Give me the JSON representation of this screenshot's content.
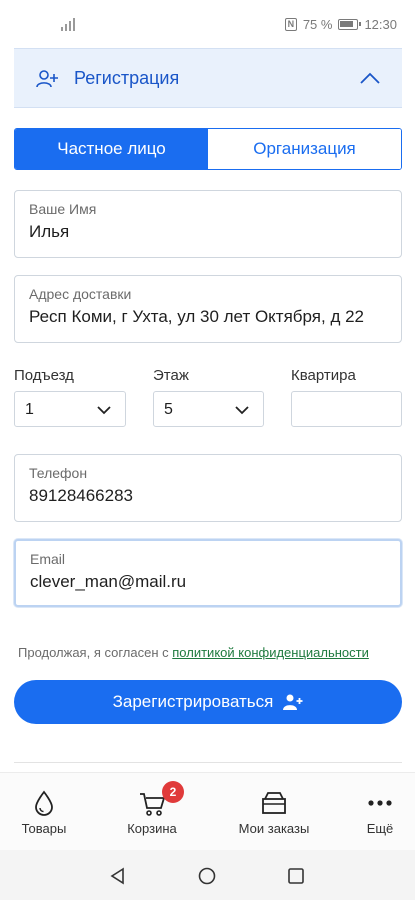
{
  "status_bar": {
    "battery_percent": "75 %",
    "time": "12:30"
  },
  "registration": {
    "title": "Регистрация",
    "expanded": true
  },
  "customer_type": {
    "options": [
      "Частное лицо",
      "Организация"
    ],
    "selected": "Частное лицо"
  },
  "form": {
    "name": {
      "label": "Ваше Имя",
      "value": "Илья"
    },
    "address": {
      "label": "Адрес доставки",
      "value": "Респ Коми, г Ухта, ул 30 лет Октября, д 22"
    },
    "entrance": {
      "label": "Подъезд",
      "value": "1"
    },
    "floor": {
      "label": "Этаж",
      "value": "5"
    },
    "apartment": {
      "label": "Квартира",
      "value": ""
    },
    "phone": {
      "label": "Телефон",
      "value": "89128466283"
    },
    "email": {
      "label": "Email",
      "value": "clever_man@mail.ru"
    }
  },
  "consent": {
    "prefix": "Продолжая, я согласен с ",
    "link": "политикой конфиденциальности"
  },
  "register_button": {
    "label": "Зарегистрироваться"
  },
  "bottom_nav": {
    "items": [
      {
        "label": "Товары",
        "icon": "drop-icon"
      },
      {
        "label": "Корзина",
        "icon": "cart-icon",
        "badge": "2"
      },
      {
        "label": "Мои заказы",
        "icon": "box-icon"
      },
      {
        "label": "Ещё",
        "icon": "more-icon"
      }
    ]
  },
  "colors": {
    "primary": "#1a6df0",
    "header_bg": "#e9f1fc",
    "badge": "#e03a3a",
    "link": "#1e7a3e"
  }
}
